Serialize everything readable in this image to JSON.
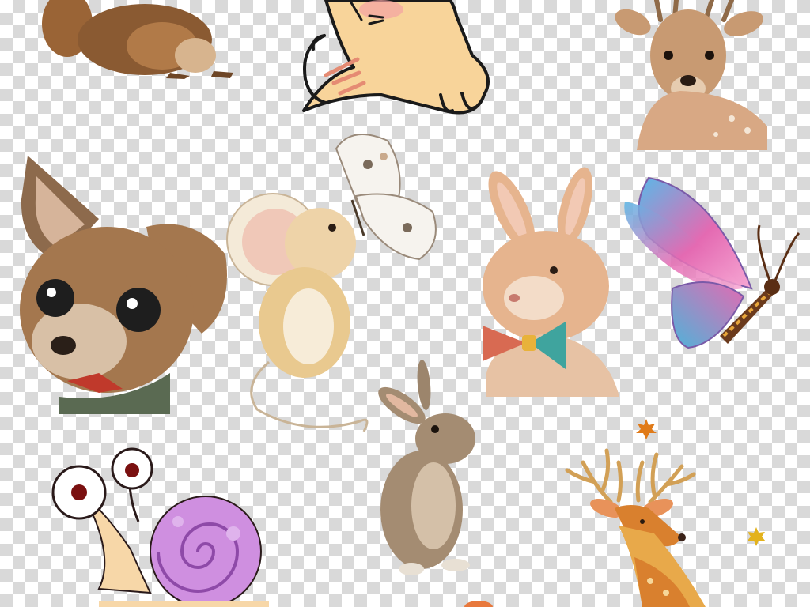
{
  "background": {
    "pattern": "transparency-checkerboard",
    "light": "#ffffff",
    "dark": "#d9d9d9"
  },
  "cliparts": [
    {
      "name": "squirrel",
      "style": "watercolor",
      "main_color": "#8a5a32"
    },
    {
      "name": "cartoon-cat",
      "style": "line-art",
      "main_color": "#f8d49a"
    },
    {
      "name": "deer-realistic",
      "style": "watercolor",
      "main_color": "#c89a72"
    },
    {
      "name": "chihuahua-puppy",
      "style": "watercolor",
      "main_color": "#a4774e"
    },
    {
      "name": "mouse-with-butterfly",
      "style": "watercolor",
      "main_color": "#e9c98f"
    },
    {
      "name": "rabbit-with-bow-tie",
      "style": "watercolor",
      "main_color": "#e6b48e"
    },
    {
      "name": "pink-butterfly",
      "style": "gradient",
      "main_color": "#e46ab2"
    },
    {
      "name": "standing-rabbit",
      "style": "photo",
      "main_color": "#a48c72"
    },
    {
      "name": "cartoon-snail",
      "style": "flat",
      "main_color": "#cf8fe0"
    },
    {
      "name": "cartoon-deer",
      "style": "flat",
      "main_color": "#d9802e"
    },
    {
      "name": "maple-leaf",
      "style": "flat",
      "main_color": "#e07a18"
    },
    {
      "name": "autumn-leaf",
      "style": "flat",
      "main_color": "#e3b21c"
    }
  ]
}
